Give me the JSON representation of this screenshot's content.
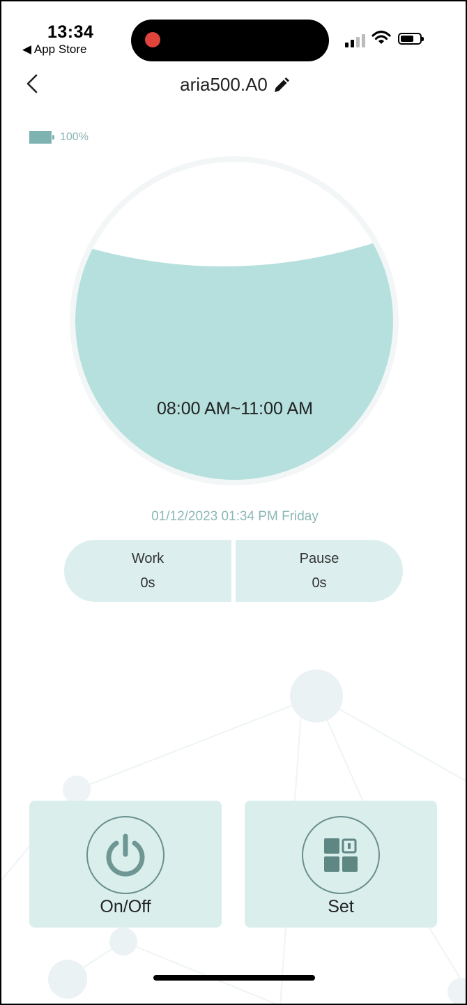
{
  "status_bar": {
    "time": "13:34",
    "back_label": "◀ App Store",
    "recording_color": "#e0443a"
  },
  "nav": {
    "title": "aria500.A0",
    "back_icon": "chevron-left-icon",
    "edit_icon": "pencil-icon"
  },
  "device": {
    "battery_percent_label": "100%",
    "battery_level": 1.0
  },
  "schedule": {
    "time_range": "08:00 AM~11:00 AM",
    "accent_color": "#b5e0dd"
  },
  "datetime": "01/12/2023 01:34 PM Friday",
  "stats": {
    "work_label": "Work",
    "work_value": "0s",
    "pause_label": "Pause",
    "pause_value": "0s"
  },
  "actions": {
    "onoff_label": "On/Off",
    "onoff_icon": "power-icon",
    "set_label": "Set",
    "set_icon": "grid-settings-icon"
  }
}
